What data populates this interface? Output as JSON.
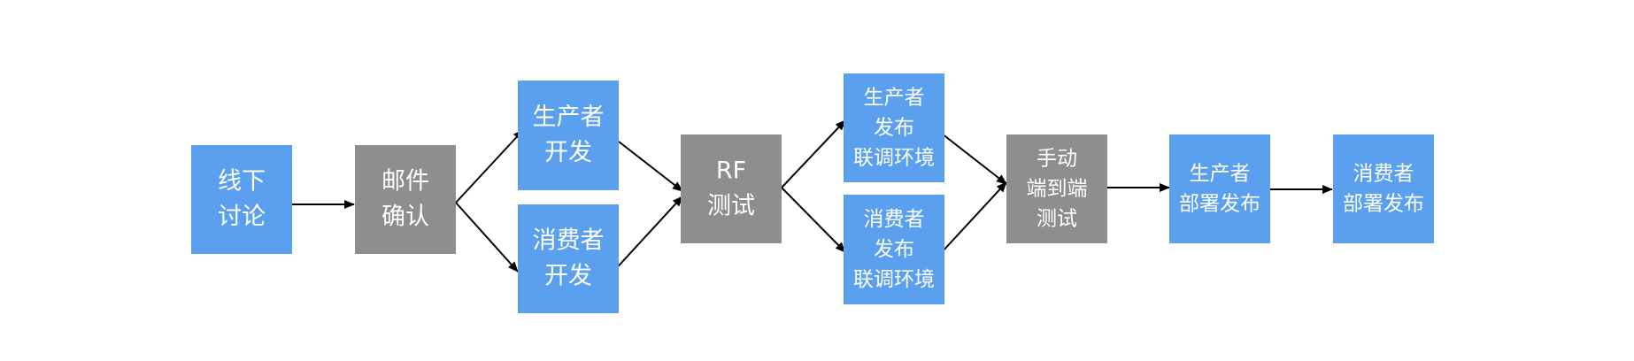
{
  "colors": {
    "blue": "#5aa0ee",
    "gray": "#8e8e8e",
    "text": "#ffffff",
    "arrow": "#000000"
  },
  "nodes": [
    {
      "id": "offline-discussion",
      "color": "blue",
      "lines": [
        "线下",
        "讨论"
      ]
    },
    {
      "id": "email-confirm",
      "color": "gray",
      "lines": [
        "邮件",
        "确认"
      ]
    },
    {
      "id": "producer-dev",
      "color": "blue",
      "lines": [
        "生产者",
        "开发"
      ]
    },
    {
      "id": "consumer-dev",
      "color": "blue",
      "lines": [
        "消费者",
        "开发"
      ]
    },
    {
      "id": "rf-test",
      "color": "gray",
      "lines": [
        "RF",
        "测试"
      ]
    },
    {
      "id": "producer-publish",
      "color": "blue",
      "lines": [
        "生产者",
        "发布",
        "联调环境"
      ]
    },
    {
      "id": "consumer-publish",
      "color": "blue",
      "lines": [
        "消费者",
        "发布",
        "联调环境"
      ]
    },
    {
      "id": "manual-e2e-test",
      "color": "gray",
      "lines": [
        "手动",
        "端到端",
        "测试"
      ]
    },
    {
      "id": "producer-deploy",
      "color": "blue",
      "lines": [
        "生产者",
        "部署发布"
      ]
    },
    {
      "id": "consumer-deploy",
      "color": "blue",
      "lines": [
        "消费者",
        "部署发布"
      ]
    }
  ],
  "edges": [
    [
      "offline-discussion",
      "email-confirm"
    ],
    [
      "email-confirm",
      "producer-dev"
    ],
    [
      "email-confirm",
      "consumer-dev"
    ],
    [
      "producer-dev",
      "rf-test"
    ],
    [
      "consumer-dev",
      "rf-test"
    ],
    [
      "rf-test",
      "producer-publish"
    ],
    [
      "rf-test",
      "consumer-publish"
    ],
    [
      "producer-publish",
      "manual-e2e-test"
    ],
    [
      "consumer-publish",
      "manual-e2e-test"
    ],
    [
      "manual-e2e-test",
      "producer-deploy"
    ],
    [
      "producer-deploy",
      "consumer-deploy"
    ]
  ]
}
